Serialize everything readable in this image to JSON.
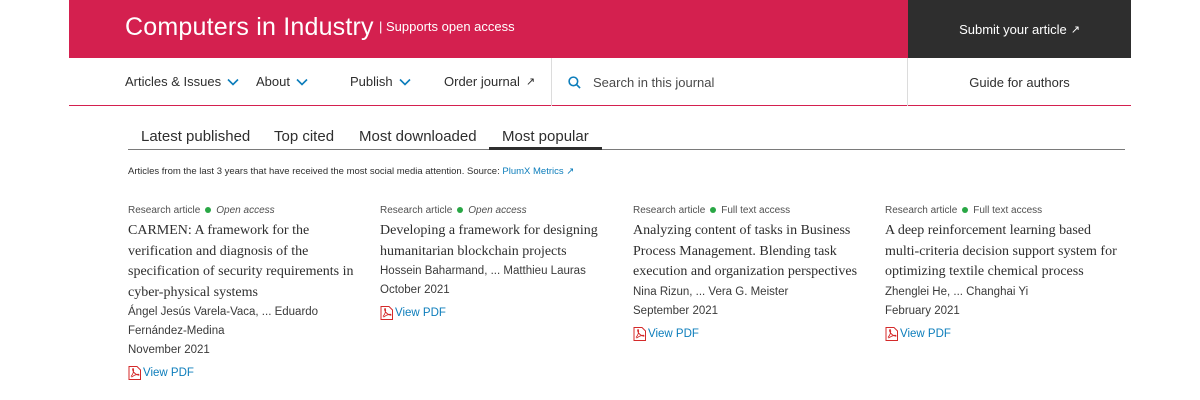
{
  "header": {
    "journal_title": "Computers in Industry",
    "open_access_tag": "| Supports open access",
    "submit_label": "Submit your article",
    "brand_color": "#d4204f"
  },
  "nav": {
    "items": [
      {
        "label": "Articles & Issues",
        "has_dropdown": true
      },
      {
        "label": "About",
        "has_dropdown": true
      },
      {
        "label": "Publish",
        "has_dropdown": true
      },
      {
        "label": "Order journal",
        "external": true
      }
    ],
    "search_placeholder": "Search in this journal",
    "guide_label": "Guide for authors"
  },
  "tabs": {
    "items": [
      "Latest published",
      "Top cited",
      "Most downloaded",
      "Most popular"
    ],
    "active": "Most popular"
  },
  "subtitle": {
    "text": "Articles from the last 3 years that have received the most social media attention. Source: ",
    "source_link": "PlumX Metrics"
  },
  "articles": [
    {
      "type": "Research article",
      "access": "Open access",
      "title": "CARMEN: A framework for the verification and diagnosis of the specification of security requirements in cyber-physical systems",
      "authors": "Ángel Jesús Varela-Vaca, ... Eduardo Fernández-Medina",
      "date": "November 2021",
      "pdf_label": "View PDF"
    },
    {
      "type": "Research article",
      "access": "Open access",
      "title": "Developing a framework for designing humanitarian blockchain projects",
      "authors": "Hossein Baharmand, ... Matthieu Lauras",
      "date": "October 2021",
      "pdf_label": "View PDF"
    },
    {
      "type": "Research article",
      "access": "Full text access",
      "title": "Analyzing content of tasks in Business Process Management. Blending task execution and organization perspectives",
      "authors": "Nina Rizun, ... Vera G. Meister",
      "date": "September 2021",
      "pdf_label": "View PDF"
    },
    {
      "type": "Research article",
      "access": "Full text access",
      "title": "A deep reinforcement learning based multi-criteria decision support system for optimizing textile chemical process",
      "authors": "Zhenglei He, ... Changhai Yi",
      "date": "February 2021",
      "pdf_label": "View PDF"
    }
  ]
}
